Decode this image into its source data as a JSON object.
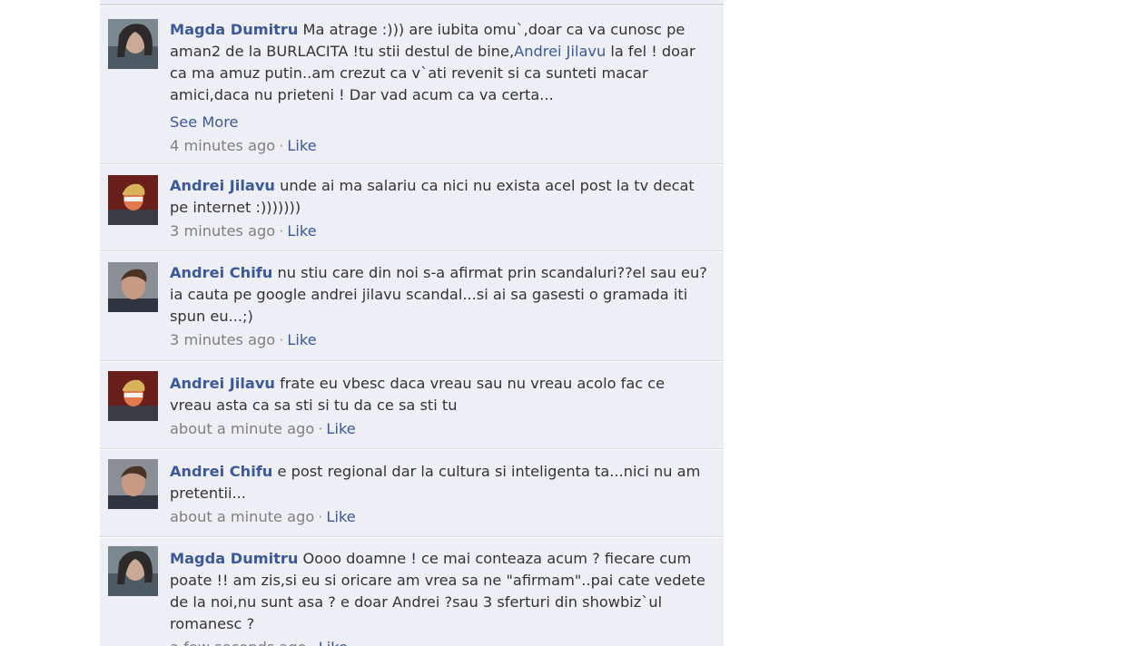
{
  "comments": [
    {
      "author": "Magda Dumitru",
      "avatar_icon": "user-photo-magda-icon",
      "text_parts": [
        "Ma atrage :))) are iubita omu`,doar ca va cunosc pe aman2 de la BURLACITA !tu stii destul de bine,",
        "Andrei Jilavu",
        " la fel ! doar ca ma amuz putin..am crezut ca v`ati revenit si ca sunteti macar amici,daca nu prieteni ! Dar vad acum ca va certa..."
      ],
      "see_more": "See More",
      "time": "4 minutes ago",
      "separator": "·",
      "like": "Like"
    },
    {
      "author": "Andrei Jilavu",
      "avatar_icon": "user-photo-andrei-jilavu-icon",
      "text": "unde ai ma salariu ca nici nu exista acel post la tv decat pe internet :)))))))",
      "time": "3 minutes ago",
      "separator": "·",
      "like": "Like"
    },
    {
      "author": "Andrei Chifu",
      "avatar_icon": "user-photo-andrei-chifu-icon",
      "text": "nu stiu care din noi s-a afirmat prin scandaluri??el sau eu? ia cauta pe google andrei jilavu scandal...si ai sa gasesti o gramada iti spun eu...;)",
      "time": "3 minutes ago",
      "separator": "·",
      "like": "Like"
    },
    {
      "author": "Andrei Jilavu",
      "avatar_icon": "user-photo-andrei-jilavu-icon",
      "text": "frate eu vbesc daca vreau sau nu vreau acolo fac ce vreau asta ca sa sti si tu da ce sa sti tu",
      "time": "about a minute ago",
      "separator": "·",
      "like": "Like"
    },
    {
      "author": "Andrei Chifu",
      "avatar_icon": "user-photo-andrei-chifu-icon",
      "text": "e post regional dar la cultura si inteligenta ta...nici nu am pretentii...",
      "time": "about a minute ago",
      "separator": "·",
      "like": "Like"
    },
    {
      "author": "Magda Dumitru",
      "avatar_icon": "user-photo-magda-icon",
      "text": "Oooo doamne ! ce mai conteaza acum ? fiecare cum poate !! am zis,si eu si oricare am vrea sa ne \"afirmam\"..pai cate vedete de la noi,nu sunt asa ? e doar Andrei ?sau 3 sferturi din showbiz`ul romanesc ?",
      "time": "a few seconds ago",
      "separator": "·",
      "like": "Like"
    }
  ],
  "colors": {
    "link": "#3b5998",
    "text": "#333333",
    "meta": "#7f7f7f",
    "panel_bg": "#edeff4"
  }
}
